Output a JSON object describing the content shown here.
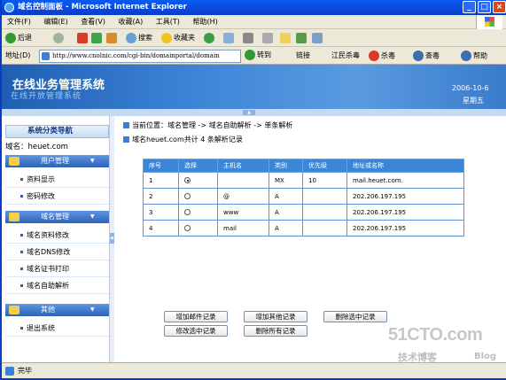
{
  "window": {
    "title": "域名控制面板 - Microsoft Internet Explorer"
  },
  "menu": [
    "文件(F)",
    "编辑(E)",
    "查看(V)",
    "收藏(A)",
    "工具(T)",
    "帮助(H)"
  ],
  "toolbar": {
    "back": "后退",
    "search": "搜索",
    "favorites": "收藏夹"
  },
  "address": {
    "label": "地址(D)",
    "url": "http://www.cnolnic.com/cgi-bin/domainportal/domain",
    "go": "转到",
    "links": "链接",
    "t1": "江民杀毒",
    "t2": "杀毒",
    "t3": "查毒",
    "t4": "帮助"
  },
  "banner": {
    "title": "在线业务管理系统",
    "subtitle": "在线开放管理系统",
    "date": "2006-10-6",
    "weekday": "星期五"
  },
  "sidebar": {
    "title": "系统分类导航",
    "domain": "域名：heuet.com",
    "groups": [
      {
        "label": "用户管理",
        "items": [
          "资料显示",
          "密码修改"
        ]
      },
      {
        "label": "域名管理",
        "items": [
          "域名资料修改",
          "域名DNS修改",
          "域名证书打印",
          "域名自助解析"
        ]
      },
      {
        "label": "其他",
        "items": [
          "退出系统"
        ]
      }
    ]
  },
  "main": {
    "breadcrumb": "当前位置：域名管理 -> 域名自助解析 -> 单条解析",
    "count": "域名heuet.com共计 4 条解析记录",
    "headers": [
      "序号",
      "选择",
      "主机名",
      "类别",
      "优先级",
      "地址或名称"
    ],
    "rows": [
      [
        "1",
        "",
        "",
        "MX",
        "10",
        "mail.heuet.com."
      ],
      [
        "2",
        "",
        "@",
        "A",
        "",
        "202.206.197.195"
      ],
      [
        "3",
        "",
        "www",
        "A",
        "",
        "202.206.197.195"
      ],
      [
        "4",
        "",
        "mail",
        "A",
        "",
        "202.206.197.195"
      ]
    ],
    "buttons": [
      "增加邮件记录",
      "增加其他记录",
      "删除选中记录",
      "修改选中记录",
      "删除所有记录"
    ]
  },
  "status": {
    "text": "完毕"
  },
  "watermark": {
    "site": "51CTO.com",
    "tagline": "技术博客",
    "blog": "Blog"
  }
}
